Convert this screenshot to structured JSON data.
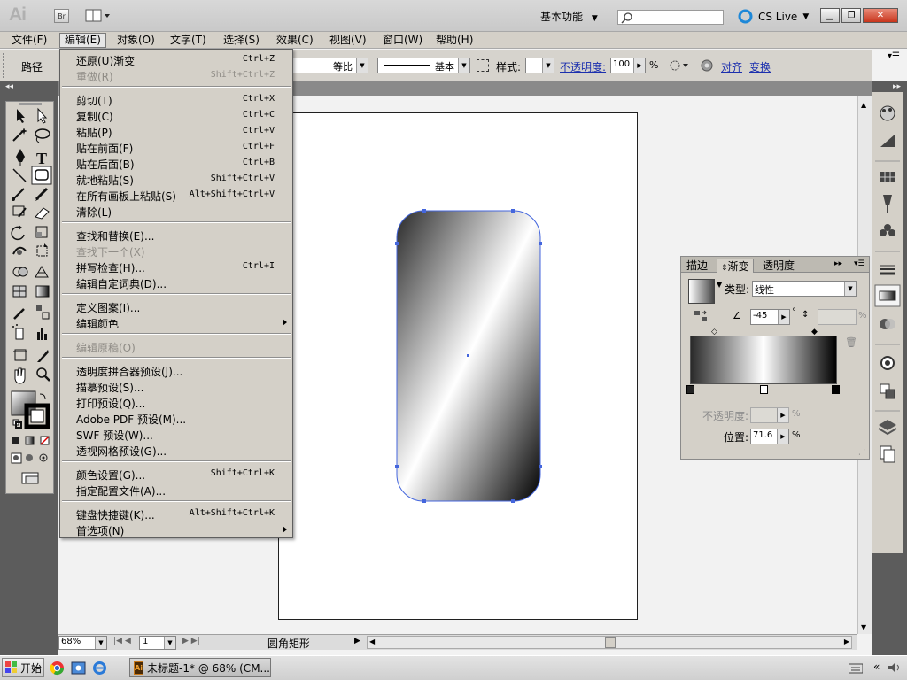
{
  "app": {
    "logo": "Ai",
    "bridge_label": "Br",
    "workspace_label": "基本功能",
    "cslive_label": "CS Live",
    "search_placeholder": ""
  },
  "menubar": [
    {
      "label": "文件(F)"
    },
    {
      "label": "编辑(E)"
    },
    {
      "label": "对象(O)"
    },
    {
      "label": "文字(T)"
    },
    {
      "label": "选择(S)"
    },
    {
      "label": "效果(C)"
    },
    {
      "label": "视图(V)"
    },
    {
      "label": "窗口(W)"
    },
    {
      "label": "帮助(H)"
    }
  ],
  "controlbar": {
    "path_label": "路径",
    "stroke_profile_label": "等比",
    "brush_label": "基本",
    "style_label": "样式:",
    "opacity_label": "不透明度:",
    "opacity_value": "100",
    "opacity_unit": "%",
    "align_label": "对齐",
    "transform_label": "变换"
  },
  "edit_menu": [
    {
      "label": "还原(U)渐变",
      "shortcut": "Ctrl+Z",
      "disabled": false
    },
    {
      "label": "重做(R)",
      "shortcut": "Shift+Ctrl+Z",
      "disabled": true
    },
    {
      "label": "剪切(T)",
      "shortcut": "Ctrl+X",
      "disabled": false
    },
    {
      "label": "复制(C)",
      "shortcut": "Ctrl+C",
      "disabled": false
    },
    {
      "label": "粘贴(P)",
      "shortcut": "Ctrl+V",
      "disabled": false
    },
    {
      "label": "贴在前面(F)",
      "shortcut": "Ctrl+F",
      "disabled": false
    },
    {
      "label": "贴在后面(B)",
      "shortcut": "Ctrl+B",
      "disabled": false
    },
    {
      "label": "就地粘贴(S)",
      "shortcut": "Shift+Ctrl+V",
      "disabled": false
    },
    {
      "label": "在所有画板上粘贴(S)",
      "shortcut": "Alt+Shift+Ctrl+V",
      "disabled": false
    },
    {
      "label": "清除(L)",
      "shortcut": "",
      "disabled": false
    },
    {
      "label": "查找和替换(E)...",
      "shortcut": "",
      "disabled": false
    },
    {
      "label": "查找下一个(X)",
      "shortcut": "",
      "disabled": true
    },
    {
      "label": "拼写检查(H)...",
      "shortcut": "Ctrl+I",
      "disabled": false
    },
    {
      "label": "编辑自定词典(D)...",
      "shortcut": "",
      "disabled": false
    },
    {
      "label": "定义图案(I)...",
      "shortcut": "",
      "disabled": false
    },
    {
      "label": "编辑颜色",
      "shortcut": "",
      "disabled": false,
      "submenu": true
    },
    {
      "label": "编辑原稿(O)",
      "shortcut": "",
      "disabled": true
    },
    {
      "label": "透明度拼合器预设(J)...",
      "shortcut": "",
      "disabled": false
    },
    {
      "label": "描摹预设(S)...",
      "shortcut": "",
      "disabled": false
    },
    {
      "label": "打印预设(Q)...",
      "shortcut": "",
      "disabled": false
    },
    {
      "label": "Adobe PDF 预设(M)...",
      "shortcut": "",
      "disabled": false
    },
    {
      "label": "SWF 预设(W)...",
      "shortcut": "",
      "disabled": false
    },
    {
      "label": "透视网格预设(G)...",
      "shortcut": "",
      "disabled": false
    },
    {
      "label": "颜色设置(G)...",
      "shortcut": "Shift+Ctrl+K",
      "disabled": false
    },
    {
      "label": "指定配置文件(A)...",
      "shortcut": "",
      "disabled": false
    },
    {
      "label": "键盘快捷键(K)...",
      "shortcut": "Alt+Shift+Ctrl+K",
      "disabled": false
    },
    {
      "label": "首选项(N)",
      "shortcut": "",
      "disabled": false,
      "submenu": true
    }
  ],
  "gradient_panel": {
    "tabs": [
      {
        "label": "描边"
      },
      {
        "label": "渐变"
      },
      {
        "label": "透明度"
      }
    ],
    "type_label": "类型:",
    "type_value": "线性",
    "angle_value": "-45",
    "angle_unit": "°",
    "aspect_unit": "%",
    "opacity_label": "不透明度:",
    "opacity_unit": "%",
    "location_label": "位置:",
    "location_value": "71.6",
    "location_unit": "%"
  },
  "statusbar": {
    "zoom_value": "68%",
    "page_value": "1",
    "tool_name": "圆角矩形"
  },
  "taskbar": {
    "start_label": "开始",
    "task_item_label": "未标题-1* @ 68% (CM..."
  },
  "colors": {
    "panel_dark": "#5c5c5c",
    "panel_light": "#d4d0c8",
    "selection_blue": "#4466dd",
    "link_blue": "#1b2fae"
  }
}
